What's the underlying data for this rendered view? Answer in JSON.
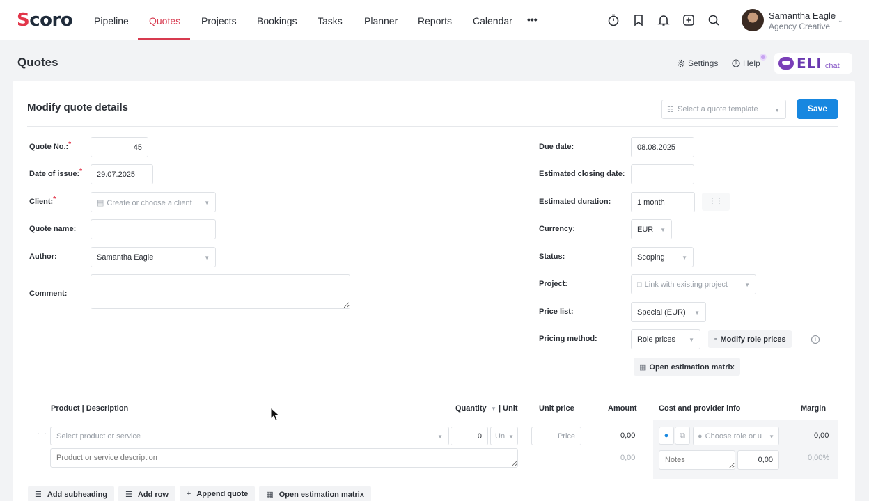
{
  "nav": {
    "logo": "Scoro",
    "items": [
      "Pipeline",
      "Quotes",
      "Projects",
      "Bookings",
      "Tasks",
      "Planner",
      "Reports",
      "Calendar"
    ],
    "more": "•••",
    "active": "Quotes",
    "icons": [
      "timer-icon",
      "bookmark-icon",
      "bell-icon",
      "add-icon",
      "search-icon"
    ],
    "user": {
      "name": "Samantha Eagle",
      "role": "Agency Creative"
    }
  },
  "header": {
    "title": "Quotes",
    "settings": "Settings",
    "help": "Help",
    "eli": {
      "label": "ELI",
      "chat": "chat"
    }
  },
  "card": {
    "title": "Modify quote details",
    "template_placeholder": "Select a quote template",
    "save": "Save"
  },
  "form_left": {
    "quote_no": {
      "label": "Quote No.:",
      "value": "45"
    },
    "date_of_issue": {
      "label": "Date of issue:",
      "value": "29.07.2025"
    },
    "client": {
      "label": "Client:",
      "placeholder": "Create or choose a client"
    },
    "quote_name": {
      "label": "Quote name:",
      "value": ""
    },
    "author": {
      "label": "Author:",
      "value": "Samantha Eagle"
    },
    "comment": {
      "label": "Comment:",
      "value": ""
    }
  },
  "form_right": {
    "due_date": {
      "label": "Due date:",
      "value": "08.08.2025"
    },
    "est_closing": {
      "label": "Estimated closing date:",
      "value": ""
    },
    "est_duration": {
      "label": "Estimated duration:",
      "value": "1 month"
    },
    "currency": {
      "label": "Currency:",
      "value": "EUR"
    },
    "status": {
      "label": "Status:",
      "value": "Scoping"
    },
    "project": {
      "label": "Project:",
      "placeholder": "Link with existing project"
    },
    "price_list": {
      "label": "Price list:",
      "value": "Special (EUR)"
    },
    "pricing_method": {
      "label": "Pricing method:",
      "value": "Role prices"
    },
    "modify_role_prices": "Modify role prices",
    "open_matrix": "Open estimation matrix"
  },
  "table": {
    "headers": {
      "product": "Product | Description",
      "quantity": "Quantity",
      "unit": "| Unit",
      "unit_price": "Unit price",
      "amount": "Amount",
      "cost": "Cost and provider info",
      "margin": "Margin"
    },
    "row": {
      "product_placeholder": "Select product or service",
      "quantity": "0",
      "unit": "Un",
      "price_placeholder": "Price",
      "amount": "0,00",
      "role_placeholder": "Choose role or u",
      "margin": "0,00",
      "description_placeholder": "Product or service description",
      "amount_sub": "0,00",
      "notes_placeholder": "Notes",
      "cost": "0,00",
      "margin_pct": "0,00%"
    }
  },
  "bottom": {
    "add_subheading": "Add subheading",
    "add_row": "Add row",
    "append_quote": "Append quote",
    "open_matrix": "Open estimation matrix"
  },
  "colors": {
    "accent": "#1787e0",
    "brand": "#d73a4f",
    "eli": "#6a39b0"
  }
}
